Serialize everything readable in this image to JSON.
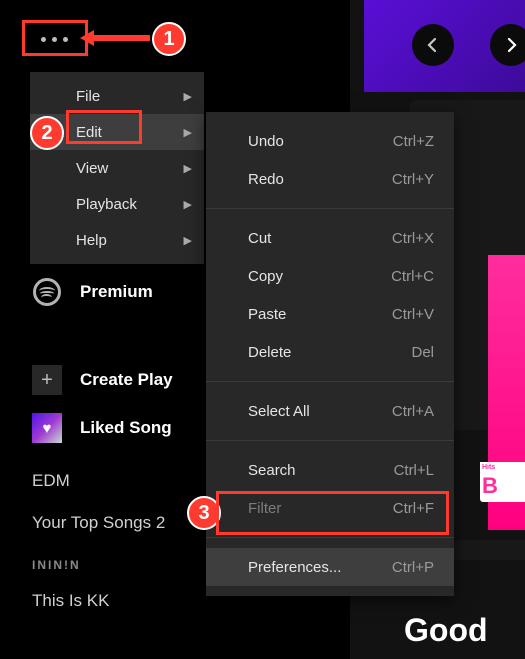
{
  "menu_button": {
    "label": "more-menu"
  },
  "main_menu": {
    "items": [
      {
        "label": "File"
      },
      {
        "label": "Edit"
      },
      {
        "label": "View"
      },
      {
        "label": "Playback"
      },
      {
        "label": "Help"
      }
    ]
  },
  "edit_menu": {
    "groups": [
      [
        {
          "label": "Undo",
          "shortcut": "Ctrl+Z"
        },
        {
          "label": "Redo",
          "shortcut": "Ctrl+Y"
        }
      ],
      [
        {
          "label": "Cut",
          "shortcut": "Ctrl+X"
        },
        {
          "label": "Copy",
          "shortcut": "Ctrl+C"
        },
        {
          "label": "Paste",
          "shortcut": "Ctrl+V"
        },
        {
          "label": "Delete",
          "shortcut": "Del"
        }
      ],
      [
        {
          "label": "Select All",
          "shortcut": "Ctrl+A"
        }
      ],
      [
        {
          "label": "Search",
          "shortcut": "Ctrl+L"
        },
        {
          "label": "Filter",
          "shortcut": "Ctrl+F",
          "disabled": true
        }
      ],
      [
        {
          "label": "Preferences...",
          "shortcut": "Ctrl+P",
          "active": true
        }
      ]
    ]
  },
  "sidebar": {
    "premium": "Premium",
    "create": "Create Play",
    "liked": "Liked Song"
  },
  "playlists": {
    "items": [
      "EDM",
      "Your Top Songs 2",
      "ININ!N",
      "This Is KK"
    ]
  },
  "right": {
    "good": "Good",
    "bb": "B",
    "hits": "Hits"
  },
  "annotations": {
    "m1": "1",
    "m2": "2",
    "m3": "3"
  }
}
